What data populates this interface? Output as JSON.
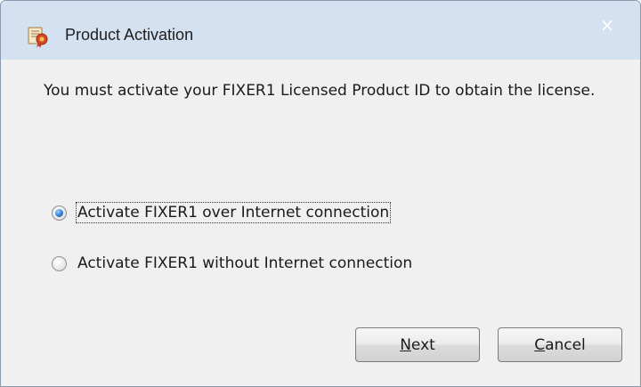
{
  "window": {
    "title": "Product Activation",
    "close_glyph": "×",
    "icon": "product-activation-icon"
  },
  "message": "You must activate your FIXER1 Licensed Product ID to obtain the license.",
  "options": [
    {
      "label": "Activate FIXER1 over Internet connection",
      "selected": true
    },
    {
      "label": "Activate FIXER1 without Internet connection",
      "selected": false
    }
  ],
  "buttons": {
    "next_first": "N",
    "next_rest": "ext",
    "cancel_first": "C",
    "cancel_rest": "ancel"
  },
  "colors": {
    "titlebar": "#d3e1f1",
    "dialog_bg": "#f0f0f0",
    "radio_accent": "#2f7fd6"
  }
}
